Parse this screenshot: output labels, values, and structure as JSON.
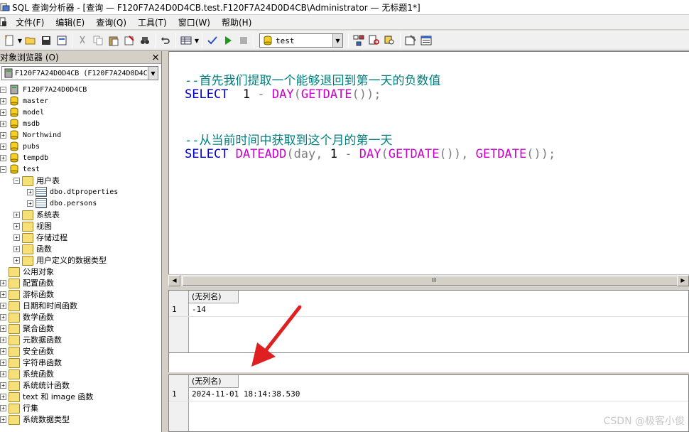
{
  "window": {
    "title": "SQL 查询分析器 - [查询 — F120F7A24D0D4CB.test.F120F7A24D0D4CB\\Administrator — 无标题1*]"
  },
  "menu": {
    "items": [
      "文件(F)",
      "编辑(E)",
      "查询(Q)",
      "工具(T)",
      "窗口(W)",
      "帮助(H)"
    ]
  },
  "toolbar": {
    "database": "test"
  },
  "object_browser": {
    "title": "对象浏览器 (O)",
    "close": "×",
    "server": "F120F7A24D0D4CB (F120F7A24D0D4CB\\",
    "root": "F120F7A24D0D4CB",
    "databases": [
      "master",
      "model",
      "msdb",
      "Northwind",
      "pubs",
      "tempdb",
      "test"
    ],
    "test_children": {
      "user_tables_label": "用户表",
      "tables": [
        "dbo.dtproperties",
        "dbo.persons"
      ],
      "others": [
        "系统表",
        "视图",
        "存储过程",
        "函数",
        "用户定义的数据类型"
      ]
    },
    "public_objects_label": "公用对象",
    "public_objects": [
      "配置函数",
      "游标函数",
      "日期和时间函数",
      "数学函数",
      "聚合函数",
      "元数据函数",
      "安全函数",
      "字符串函数",
      "系统函数",
      "系统统计函数",
      "text 和 image 函数",
      "行集",
      "系统数据类型"
    ]
  },
  "editor": {
    "line1_comment": "--首先我们提取一个能够退回到第一天的负数值",
    "line2": {
      "kw": "SELECT",
      "num": "1",
      "op": "-",
      "fn1": "DAY",
      "paren1": "(",
      "fn2": "GETDATE",
      "paren2": "());"
    },
    "line3_comment": "--从当前时间中获取到这个月的第一天",
    "line4": {
      "kw": "SELECT",
      "fn1": "DATEADD",
      "arg": "(day,",
      "num": "1",
      "op": "-",
      "fn2": "DAY",
      "p1": "(",
      "fn3": "GETDATE",
      "p2": "()),",
      "fn4": "GETDATE",
      "p3": "());"
    }
  },
  "scrollbar": {
    "left": "◀",
    "thumb": "III",
    "right": "▶"
  },
  "results": [
    {
      "header": "(无列名)",
      "row": "1",
      "value": "-14"
    },
    {
      "header": "(无列名)",
      "row": "1",
      "value": "2024-11-01 18:14:38.530"
    }
  ],
  "watermark": "CSDN @极客小俊"
}
